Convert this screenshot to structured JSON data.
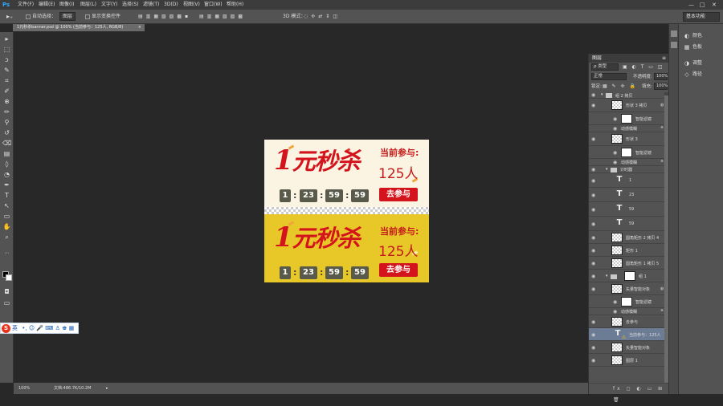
{
  "app": {
    "logo": "Ps"
  },
  "menu": [
    "文件(F)",
    "编辑(E)",
    "图像(I)",
    "图层(L)",
    "文字(Y)",
    "选择(S)",
    "滤镜(T)",
    "3D(D)",
    "视图(V)",
    "窗口(W)",
    "帮助(H)"
  ],
  "window_controls": [
    "—",
    "□",
    "✕"
  ],
  "options": {
    "auto_select_label": "自动选择：",
    "auto_select_value": "图层",
    "show_transform_label": "显示变换控件",
    "mode_3d_label": "3D 模式：",
    "workspace": "基本功能"
  },
  "doc_tab": {
    "title": "1元秒杀banner.psd @ 100% (当前参与：125人, RGB/8)",
    "close": "×"
  },
  "tools": [
    "move-icon",
    "marquee-icon",
    "lasso-icon",
    "quick-select-icon",
    "crop-icon",
    "eyedropper-icon",
    "healing-icon",
    "brush-icon",
    "stamp-icon",
    "history-brush-icon",
    "eraser-icon",
    "gradient-icon",
    "blur-icon",
    "dodge-icon",
    "pen-icon",
    "type-icon",
    "path-select-icon",
    "shape-icon",
    "hand-icon",
    "zoom-icon"
  ],
  "tool_glyphs": [
    "▸",
    "⬚",
    "ↄ",
    "✎",
    "⌗",
    "✐",
    "⊕",
    "✏",
    "⚲",
    "↺",
    "⌫",
    "▤",
    "◊",
    "◔",
    "✒",
    "T",
    "↖",
    "▭",
    "✋",
    "⌕"
  ],
  "status": {
    "zoom": "100%",
    "doc_info": "文档:486.7K/10.2M",
    "arrow": "▸"
  },
  "ime": {
    "logo": "S",
    "lang": "英",
    "icons": "•, ☺ 🎤 ⌨ ♙ ♚ ▦"
  },
  "banner": {
    "title_digit": "1",
    "title_text": "元秒杀",
    "participants_label": "当前参与:",
    "participants_count": "125人",
    "countdown": [
      "1",
      "23",
      "59",
      "59"
    ],
    "colon": ":",
    "cta": "去参与",
    "colors": {
      "top_bg": "#fbf4e3",
      "bottom_bg": "#e8c828",
      "accent_red": "#d4141c",
      "countdown_bg": "#5a5a4a"
    }
  },
  "dock": {
    "items": [
      {
        "icon": "color-icon",
        "glyph": "◐",
        "label": "颜色"
      },
      {
        "icon": "swatches-icon",
        "glyph": "▦",
        "label": "色板"
      },
      {
        "icon": "adjustments-icon",
        "glyph": "◑",
        "label": "调整"
      },
      {
        "icon": "paths-icon",
        "glyph": "◇",
        "label": "路径"
      }
    ]
  },
  "layers_panel": {
    "title": "图层",
    "kind_filter": "ρ 类型",
    "blend_mode": "正常",
    "opacity_label": "不透明度:",
    "opacity_value": "100%",
    "lock_label": "锁定:",
    "fill_label": "填充:",
    "fill_value": "100%",
    "footer": "fx ◻ ◐ ▭ ⊞ 🗑",
    "layers": [
      {
        "name": "组 2 拷贝",
        "type": "group"
      },
      {
        "name": "形状 3 拷贝",
        "type": "smart"
      },
      {
        "name": "智能滤镜",
        "type": "filter-mask"
      },
      {
        "name": "动感模糊",
        "type": "filter"
      },
      {
        "name": "形状 3",
        "type": "smart"
      },
      {
        "name": "智能滤镜",
        "type": "filter-mask"
      },
      {
        "name": "动感模糊",
        "type": "filter"
      },
      {
        "name": "计时器",
        "type": "group"
      },
      {
        "name": "1",
        "type": "text"
      },
      {
        "name": "23",
        "type": "text"
      },
      {
        "name": "59",
        "type": "text"
      },
      {
        "name": "59",
        "type": "text"
      },
      {
        "name": "圆角矩形 2 拷贝 4",
        "type": "shape"
      },
      {
        "name": "矩形 1",
        "type": "shape"
      },
      {
        "name": "圆角矩形 1 拷贝 5",
        "type": "shape"
      },
      {
        "name": "组 1",
        "type": "group"
      },
      {
        "name": "矢量智能对象",
        "type": "smart"
      },
      {
        "name": "智能滤镜",
        "type": "filter-mask"
      },
      {
        "name": "动感模糊",
        "type": "filter"
      },
      {
        "name": "去参与",
        "type": "shape"
      },
      {
        "name": "当前参与：125人",
        "type": "text",
        "selected": true
      },
      {
        "name": "矢量智能对象",
        "type": "smart"
      },
      {
        "name": "图层 1",
        "type": "shape"
      }
    ]
  }
}
